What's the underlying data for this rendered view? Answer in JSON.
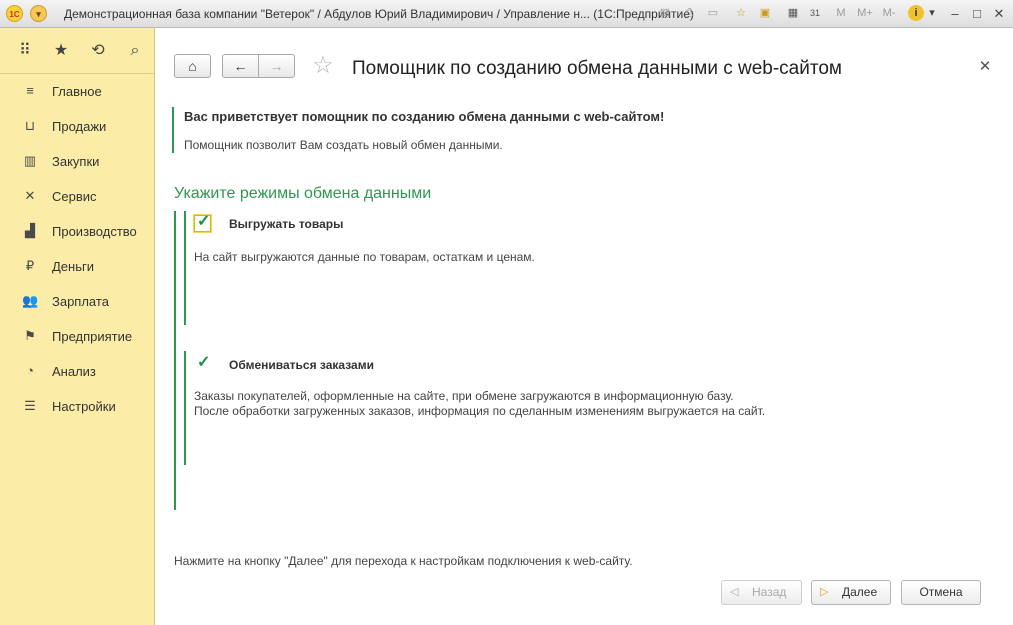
{
  "titlebar": {
    "app_logo": "1С",
    "title": "Демонстрационная база компании \"Ветерок\" / Абдулов Юрий Владимирович / Управление н...  (1С:Предприятие)",
    "tools": [
      "M",
      "M+",
      "M-"
    ],
    "calendar": "31",
    "info_icon": "i"
  },
  "sidebar": {
    "items": [
      {
        "label": "Главное",
        "icon": "list-icon"
      },
      {
        "label": "Продажи",
        "icon": "basket-icon"
      },
      {
        "label": "Закупки",
        "icon": "barcode-icon"
      },
      {
        "label": "Сервис",
        "icon": "tools-icon"
      },
      {
        "label": "Производство",
        "icon": "factory-icon"
      },
      {
        "label": "Деньги",
        "icon": "ruble-icon"
      },
      {
        "label": "Зарплата",
        "icon": "people-icon"
      },
      {
        "label": "Предприятие",
        "icon": "flag-icon"
      },
      {
        "label": "Анализ",
        "icon": "pie-chart-icon"
      },
      {
        "label": "Настройки",
        "icon": "settings-icon"
      }
    ]
  },
  "page": {
    "title": "Помощник по созданию обмена данными с web-сайтом",
    "welcome_title": "Вас приветствует помощник по созданию обмена данными с web-сайтом!",
    "welcome_text": "Помощник позволит Вам создать новый обмен данными.",
    "section_title": "Укажите режимы обмена данными",
    "options": [
      {
        "label": "Выгружать товары",
        "checked": true,
        "desc": [
          "На сайт выгружаются данные по товарам, остаткам и ценам."
        ]
      },
      {
        "label": "Обмениваться заказами",
        "checked": true,
        "desc": [
          "Заказы покупателей, оформленные на сайте, при обмене загружаются в информационную базу.",
          "После обработки загруженных заказов, информация по сделанным изменениям выгружается на сайт."
        ]
      }
    ],
    "footer_hint": "Нажмите на кнопку \"Далее\" для перехода к настройкам подключения к web-сайту."
  },
  "buttons": {
    "prev": "Назад",
    "next": "Далее",
    "cancel": "Отмена"
  },
  "colors": {
    "accent_green": "#2f9650",
    "sidebar_bg": "#fbeda7"
  }
}
